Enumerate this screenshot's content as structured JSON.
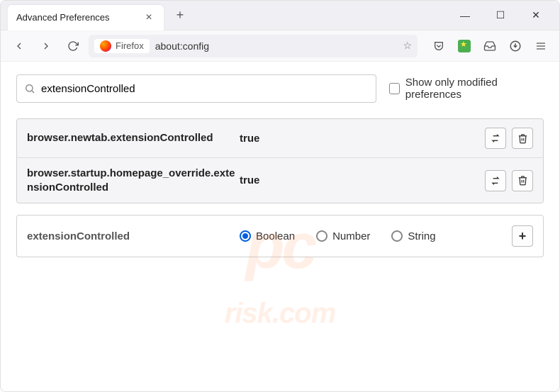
{
  "window": {
    "tab_title": "Advanced Preferences",
    "minimize": "—",
    "maximize": "☐",
    "close": "✕",
    "newtab": "+"
  },
  "nav": {
    "ff_label": "Firefox",
    "url": "about:config"
  },
  "search": {
    "value": "extensionControlled",
    "only_modified": "Show only modified preferences"
  },
  "prefs": [
    {
      "name": "browser.newtab.extensionControlled",
      "value": "true"
    },
    {
      "name": "browser.startup.homepage_override.extensionControlled",
      "value": "true"
    }
  ],
  "create": {
    "name": "extensionControlled",
    "types": [
      "Boolean",
      "Number",
      "String"
    ],
    "selected": "Boolean",
    "add": "+"
  },
  "watermark": {
    "big": "pc",
    "rest": "risk.com"
  }
}
